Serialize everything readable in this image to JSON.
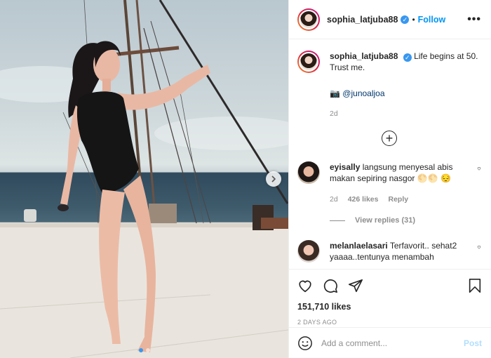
{
  "post": {
    "author": "sophia_latjuba88",
    "follow_label": "Follow",
    "more_icon": "more-horizontal-icon",
    "verified_icon": "verified-badge-icon"
  },
  "caption": {
    "username": "sophia_latjuba88",
    "text": "Life begins at 50. Trust me.",
    "camera_emoji": "📷",
    "tagged_user": "@junoaljoa",
    "age": "2d"
  },
  "load_more_icon": "plus-circle-icon",
  "comments": [
    {
      "username": "eyisally",
      "text": "langsung menyesal abis makan sepiring nasgor 🌕🌕 😔",
      "age": "2d",
      "likes": "426 likes",
      "reply_label": "Reply",
      "view_replies": "View replies (31)"
    },
    {
      "username": "melanlaelasari",
      "text": "Terfavorit.. sehat2 yaaaa..tentunya menambah"
    }
  ],
  "actions": {
    "likes": "151,710 likes",
    "timestamp": "2 DAYS AGO"
  },
  "add_comment": {
    "placeholder": "Add a comment...",
    "post_label": "Post",
    "emoji_icon": "smiley-icon"
  },
  "colors": {
    "accent": "#0095f6",
    "post_disabled": "#b2dffc",
    "muted": "#8e8e8e"
  }
}
